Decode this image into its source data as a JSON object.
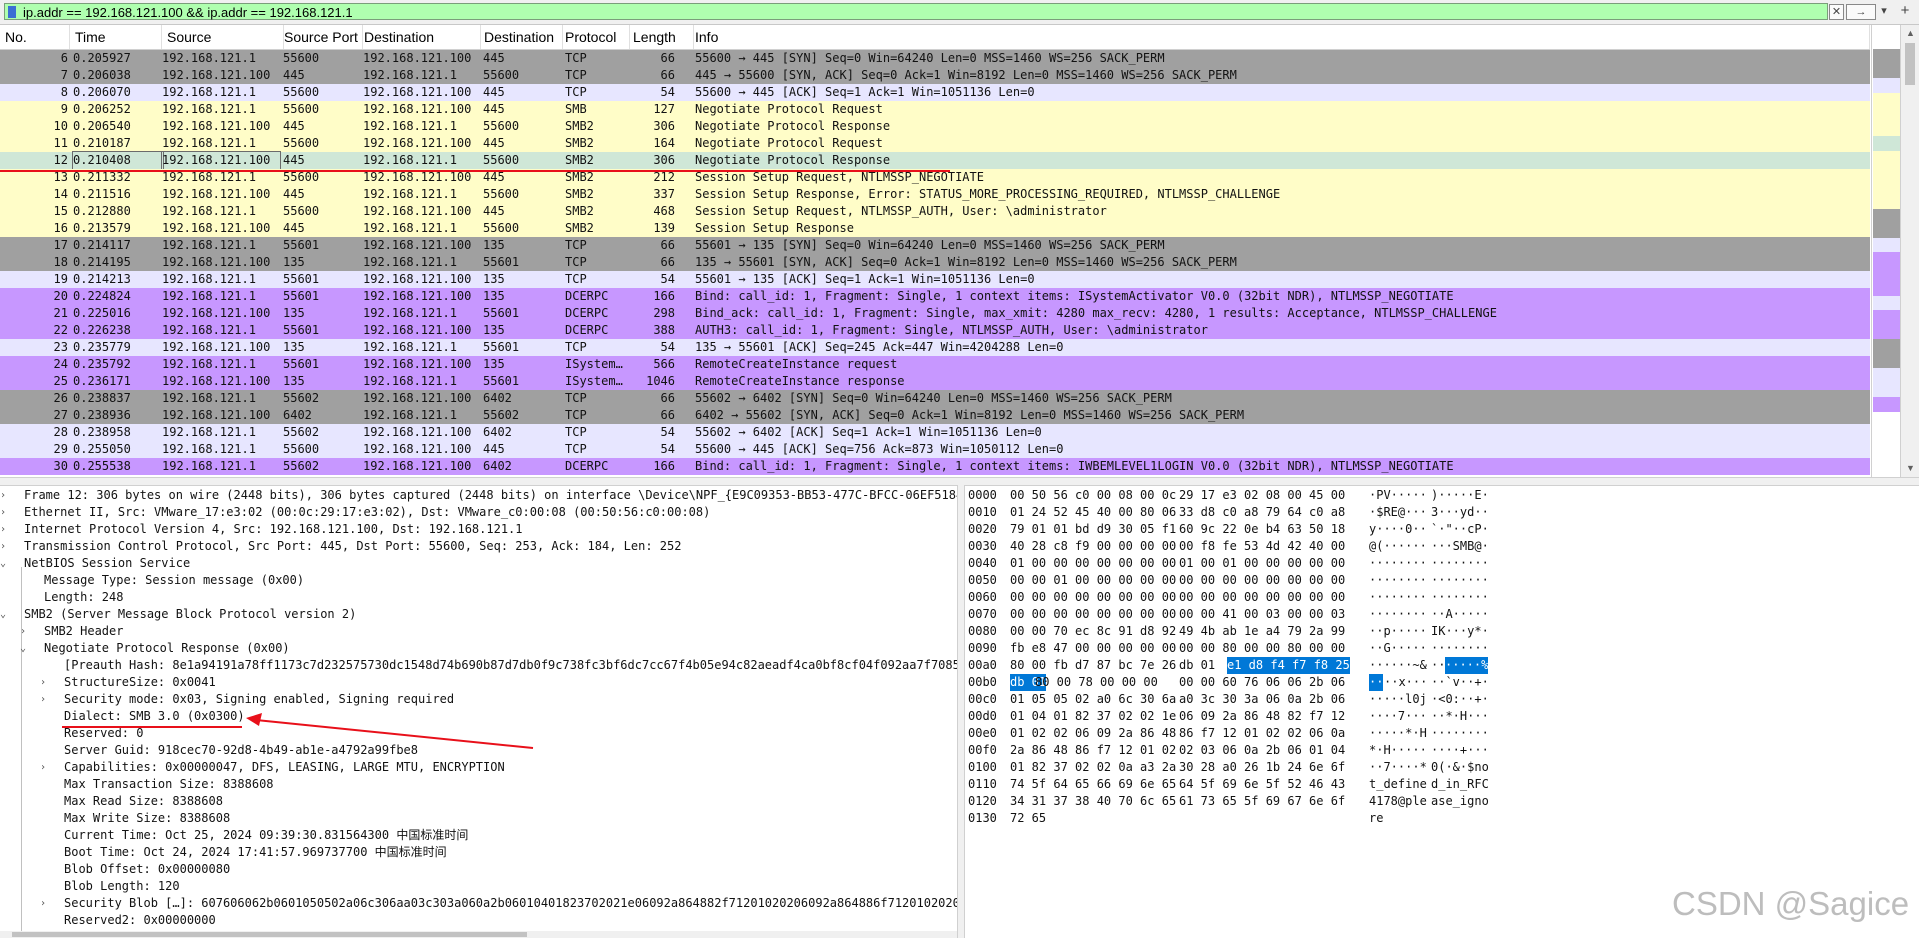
{
  "filter": {
    "value": "ip.addr == 192.168.121.100 && ip.addr == 192.168.121.1",
    "clear_label": "✕",
    "apply_label": "→",
    "dropdown_label": "▾",
    "add_label": "+"
  },
  "columns": [
    "No.",
    "Time",
    "Source",
    "Source Port",
    "Destination",
    "Destination",
    "Protocol",
    "Length",
    "Info"
  ],
  "colors": {
    "tcp_syn": "#a0a0a0",
    "tcp": "#e7e6ff",
    "smb": "#fffdc8",
    "dcerpc": "#c797ff",
    "selected": "#cfe7d7",
    "annotation": "#e8101a",
    "highlight": "#0078d7"
  },
  "packets": [
    {
      "no": "6",
      "time": "0.205927",
      "src": "192.168.121.1",
      "sport": "55600",
      "dst": "192.168.121.100",
      "dport": "445",
      "proto": "TCP",
      "len": "66",
      "info": "55600 → 445 [SYN] Seq=0 Win=64240 Len=0 MSS=1460 WS=256 SACK_PERM",
      "type": "syn"
    },
    {
      "no": "7",
      "time": "0.206038",
      "src": "192.168.121.100",
      "sport": "445",
      "dst": "192.168.121.1",
      "dport": "55600",
      "proto": "TCP",
      "len": "66",
      "info": "445 → 55600 [SYN, ACK] Seq=0 Ack=1 Win=8192 Len=0 MSS=1460 WS=256 SACK_PERM",
      "type": "syn"
    },
    {
      "no": "8",
      "time": "0.206070",
      "src": "192.168.121.1",
      "sport": "55600",
      "dst": "192.168.121.100",
      "dport": "445",
      "proto": "TCP",
      "len": "54",
      "info": "55600 → 445 [ACK] Seq=1 Ack=1 Win=1051136 Len=0",
      "type": "tcp"
    },
    {
      "no": "9",
      "time": "0.206252",
      "src": "192.168.121.1",
      "sport": "55600",
      "dst": "192.168.121.100",
      "dport": "445",
      "proto": "SMB",
      "len": "127",
      "info": "Negotiate Protocol Request",
      "type": "smb"
    },
    {
      "no": "10",
      "time": "0.206540",
      "src": "192.168.121.100",
      "sport": "445",
      "dst": "192.168.121.1",
      "dport": "55600",
      "proto": "SMB2",
      "len": "306",
      "info": "Negotiate Protocol Response",
      "type": "smb"
    },
    {
      "no": "11",
      "time": "0.210187",
      "src": "192.168.121.1",
      "sport": "55600",
      "dst": "192.168.121.100",
      "dport": "445",
      "proto": "SMB2",
      "len": "164",
      "info": "Negotiate Protocol Request",
      "type": "smb"
    },
    {
      "no": "12",
      "time": "0.210408",
      "src": "192.168.121.100",
      "sport": "445",
      "dst": "192.168.121.1",
      "dport": "55600",
      "proto": "SMB2",
      "len": "306",
      "info": "Negotiate Protocol Response",
      "type": "selected"
    },
    {
      "no": "13",
      "time": "0.211332",
      "src": "192.168.121.1",
      "sport": "55600",
      "dst": "192.168.121.100",
      "dport": "445",
      "proto": "SMB2",
      "len": "212",
      "info": "Session Setup Request, NTLMSSP_NEGOTIATE",
      "type": "smb"
    },
    {
      "no": "14",
      "time": "0.211516",
      "src": "192.168.121.100",
      "sport": "445",
      "dst": "192.168.121.1",
      "dport": "55600",
      "proto": "SMB2",
      "len": "337",
      "info": "Session Setup Response, Error: STATUS_MORE_PROCESSING_REQUIRED, NTLMSSP_CHALLENGE",
      "type": "smb"
    },
    {
      "no": "15",
      "time": "0.212880",
      "src": "192.168.121.1",
      "sport": "55600",
      "dst": "192.168.121.100",
      "dport": "445",
      "proto": "SMB2",
      "len": "468",
      "info": "Session Setup Request, NTLMSSP_AUTH, User: \\administrator",
      "type": "smb"
    },
    {
      "no": "16",
      "time": "0.213579",
      "src": "192.168.121.100",
      "sport": "445",
      "dst": "192.168.121.1",
      "dport": "55600",
      "proto": "SMB2",
      "len": "139",
      "info": "Session Setup Response",
      "type": "smb"
    },
    {
      "no": "17",
      "time": "0.214117",
      "src": "192.168.121.1",
      "sport": "55601",
      "dst": "192.168.121.100",
      "dport": "135",
      "proto": "TCP",
      "len": "66",
      "info": "55601 → 135 [SYN] Seq=0 Win=64240 Len=0 MSS=1460 WS=256 SACK_PERM",
      "type": "syn"
    },
    {
      "no": "18",
      "time": "0.214195",
      "src": "192.168.121.100",
      "sport": "135",
      "dst": "192.168.121.1",
      "dport": "55601",
      "proto": "TCP",
      "len": "66",
      "info": "135 → 55601 [SYN, ACK] Seq=0 Ack=1 Win=8192 Len=0 MSS=1460 WS=256 SACK_PERM",
      "type": "syn"
    },
    {
      "no": "19",
      "time": "0.214213",
      "src": "192.168.121.1",
      "sport": "55601",
      "dst": "192.168.121.100",
      "dport": "135",
      "proto": "TCP",
      "len": "54",
      "info": "55601 → 135 [ACK] Seq=1 Ack=1 Win=1051136 Len=0",
      "type": "tcp"
    },
    {
      "no": "20",
      "time": "0.224824",
      "src": "192.168.121.1",
      "sport": "55601",
      "dst": "192.168.121.100",
      "dport": "135",
      "proto": "DCERPC",
      "len": "166",
      "info": "Bind: call_id: 1, Fragment: Single, 1 context items: ISystemActivator V0.0 (32bit NDR), NTLMSSP_NEGOTIATE",
      "type": "dcerpc"
    },
    {
      "no": "21",
      "time": "0.225016",
      "src": "192.168.121.100",
      "sport": "135",
      "dst": "192.168.121.1",
      "dport": "55601",
      "proto": "DCERPC",
      "len": "298",
      "info": "Bind_ack: call_id: 1, Fragment: Single, max_xmit: 4280 max_recv: 4280, 1 results: Acceptance, NTLMSSP_CHALLENGE",
      "type": "dcerpc"
    },
    {
      "no": "22",
      "time": "0.226238",
      "src": "192.168.121.1",
      "sport": "55601",
      "dst": "192.168.121.100",
      "dport": "135",
      "proto": "DCERPC",
      "len": "388",
      "info": "AUTH3: call_id: 1, Fragment: Single, NTLMSSP_AUTH, User: \\administrator",
      "type": "dcerpc"
    },
    {
      "no": "23",
      "time": "0.235779",
      "src": "192.168.121.100",
      "sport": "135",
      "dst": "192.168.121.1",
      "dport": "55601",
      "proto": "TCP",
      "len": "54",
      "info": "135 → 55601 [ACK] Seq=245 Ack=447 Win=4204288 Len=0",
      "type": "tcp"
    },
    {
      "no": "24",
      "time": "0.235792",
      "src": "192.168.121.1",
      "sport": "55601",
      "dst": "192.168.121.100",
      "dport": "135",
      "proto": "ISystem…",
      "len": "566",
      "info": "RemoteCreateInstance request",
      "type": "dcerpc"
    },
    {
      "no": "25",
      "time": "0.236171",
      "src": "192.168.121.100",
      "sport": "135",
      "dst": "192.168.121.1",
      "dport": "55601",
      "proto": "ISystem…",
      "len": "1046",
      "info": "RemoteCreateInstance response",
      "type": "dcerpc"
    },
    {
      "no": "26",
      "time": "0.238837",
      "src": "192.168.121.1",
      "sport": "55602",
      "dst": "192.168.121.100",
      "dport": "6402",
      "proto": "TCP",
      "len": "66",
      "info": "55602 → 6402 [SYN] Seq=0 Win=64240 Len=0 MSS=1460 WS=256 SACK_PERM",
      "type": "syn"
    },
    {
      "no": "27",
      "time": "0.238936",
      "src": "192.168.121.100",
      "sport": "6402",
      "dst": "192.168.121.1",
      "dport": "55602",
      "proto": "TCP",
      "len": "66",
      "info": "6402 → 55602 [SYN, ACK] Seq=0 Ack=1 Win=8192 Len=0 MSS=1460 WS=256 SACK_PERM",
      "type": "syn"
    },
    {
      "no": "28",
      "time": "0.238958",
      "src": "192.168.121.1",
      "sport": "55602",
      "dst": "192.168.121.100",
      "dport": "6402",
      "proto": "TCP",
      "len": "54",
      "info": "55602 → 6402 [ACK] Seq=1 Ack=1 Win=1051136 Len=0",
      "type": "tcp"
    },
    {
      "no": "29",
      "time": "0.255050",
      "src": "192.168.121.1",
      "sport": "55600",
      "dst": "192.168.121.100",
      "dport": "445",
      "proto": "TCP",
      "len": "54",
      "info": "55600 → 445 [ACK] Seq=756 Ack=873 Win=1050112 Len=0",
      "type": "tcp"
    },
    {
      "no": "30",
      "time": "0.255538",
      "src": "192.168.121.1",
      "sport": "55602",
      "dst": "192.168.121.100",
      "dport": "6402",
      "proto": "DCERPC",
      "len": "166",
      "info": "Bind: call_id: 1, Fragment: Single, 1 context items: IWBEMLEVEL1LOGIN V0.0 (32bit NDR), NTLMSSP_NEGOTIATE",
      "type": "dcerpc"
    }
  ],
  "details": [
    {
      "text": "Frame 12: 306 bytes on wire (2448 bits), 306 bytes captured (2448 bits) on interface \\Device\\NPF_{E9C09353-BB53-477C-BFCC-06EF5184AA6",
      "indent": 0,
      "arrow": "›"
    },
    {
      "text": "Ethernet II, Src: VMware_17:e3:02 (00:0c:29:17:e3:02), Dst: VMware_c0:00:08 (00:50:56:c0:00:08)",
      "indent": 0,
      "arrow": "›"
    },
    {
      "text": "Internet Protocol Version 4, Src: 192.168.121.100, Dst: 192.168.121.1",
      "indent": 0,
      "arrow": "›"
    },
    {
      "text": "Transmission Control Protocol, Src Port: 445, Dst Port: 55600, Seq: 253, Ack: 184, Len: 252",
      "indent": 0,
      "arrow": "›"
    },
    {
      "text": "NetBIOS Session Service",
      "indent": 0,
      "arrow": "⌄"
    },
    {
      "text": "Message Type: Session message (0x00)",
      "indent": 1,
      "arrow": ""
    },
    {
      "text": "Length: 248",
      "indent": 1,
      "arrow": ""
    },
    {
      "text": "SMB2 (Server Message Block Protocol version 2)",
      "indent": 0,
      "arrow": "⌄"
    },
    {
      "text": "SMB2 Header",
      "indent": 1,
      "arrow": "›"
    },
    {
      "text": "Negotiate Protocol Response (0x00)",
      "indent": 1,
      "arrow": "⌄"
    },
    {
      "text": "[Preauth Hash: 8e1a94191a78ff1173c7d232575730dc1548d74b690b87d7db0f9c738fc3bf6dc7cc67f4b05e94c82aeadf4ca0bf8cf04f092aa7f70859865",
      "indent": 2,
      "arrow": ""
    },
    {
      "text": "StructureSize: 0x0041",
      "indent": 2,
      "arrow": "›"
    },
    {
      "text": "Security mode: 0x03, Signing enabled, Signing required",
      "indent": 2,
      "arrow": "›"
    },
    {
      "text": "Dialect: SMB 3.0 (0x0300)",
      "indent": 2,
      "arrow": ""
    },
    {
      "text": "Reserved: 0",
      "indent": 2,
      "arrow": ""
    },
    {
      "text": "Server Guid: 918cec70-92d8-4b49-ab1e-a4792a99fbe8",
      "indent": 2,
      "arrow": ""
    },
    {
      "text": "Capabilities: 0x00000047, DFS, LEASING, LARGE MTU, ENCRYPTION",
      "indent": 2,
      "arrow": "›"
    },
    {
      "text": "Max Transaction Size: 8388608",
      "indent": 2,
      "arrow": ""
    },
    {
      "text": "Max Read Size: 8388608",
      "indent": 2,
      "arrow": ""
    },
    {
      "text": "Max Write Size: 8388608",
      "indent": 2,
      "arrow": ""
    },
    {
      "text": "Current Time: Oct 25, 2024 09:39:30.831564300 中国标准时间",
      "indent": 2,
      "arrow": ""
    },
    {
      "text": "Boot Time: Oct 24, 2024 17:41:57.969737700 中国标准时间",
      "indent": 2,
      "arrow": ""
    },
    {
      "text": "Blob Offset: 0x00000080",
      "indent": 2,
      "arrow": ""
    },
    {
      "text": "Blob Length: 120",
      "indent": 2,
      "arrow": ""
    },
    {
      "text": "Security Blob […]: 607606062b0601050502a06c306aa03c303a060a2b06010401823702021e06092a864882f71201020206092a864886f712010202060a",
      "indent": 2,
      "arrow": "›"
    },
    {
      "text": "Reserved2: 0x00000000",
      "indent": 2,
      "arrow": ""
    }
  ],
  "bytes": [
    {
      "off": "0000",
      "h1": "00 50 56 c0 00 08 00 0c",
      "h2": "29 17 e3 02 08 00 45 00",
      "a1": "·PV·····",
      "a2": ")·····E·"
    },
    {
      "off": "0010",
      "h1": "01 24 52 45 40 00 80 06",
      "h2": "33 d8 c0 a8 79 64 c0 a8",
      "a1": "·$RE@···",
      "a2": "3···yd··"
    },
    {
      "off": "0020",
      "h1": "79 01 01 bd d9 30 05 f1",
      "h2": "60 9c 22 0e b4 63 50 18",
      "a1": "y····0··",
      "a2": "`·\"··cP·"
    },
    {
      "off": "0030",
      "h1": "40 28 c8 f9 00 00 00 00",
      "h2": "00 f8 fe 53 4d 42 40 00",
      "a1": "@(······",
      "a2": "···SMB@·"
    },
    {
      "off": "0040",
      "h1": "01 00 00 00 00 00 00 00",
      "h2": "01 00 01 00 00 00 00 00",
      "a1": "········",
      "a2": "········"
    },
    {
      "off": "0050",
      "h1": "00 00 01 00 00 00 00 00",
      "h2": "00 00 00 00 00 00 00 00",
      "a1": "········",
      "a2": "········"
    },
    {
      "off": "0060",
      "h1": "00 00 00 00 00 00 00 00",
      "h2": "00 00 00 00 00 00 00 00",
      "a1": "········",
      "a2": "········"
    },
    {
      "off": "0070",
      "h1": "00 00 00 00 00 00 00 00",
      "h2": "00 00 41 00 03 00 00 03",
      "a1": "········",
      "a2": "··A·····"
    },
    {
      "off": "0080",
      "h1": "00 00 70 ec 8c 91 d8 92",
      "h2": "49 4b ab 1e a4 79 2a 99",
      "a1": "··p·····",
      "a2": "IK···y*·"
    },
    {
      "off": "0090",
      "h1": "fb e8 47 00 00 00 00 00",
      "h2": "00 00 80 00 00 80 00 00",
      "a1": "··G·····",
      "a2": "········"
    },
    {
      "off": "00a0",
      "h1": "80 00 fb d7 87 bc 7e 26",
      "h2": "db 01",
      "h2b": "e1 d8 f4 f7 f8 25",
      "a1": "······~&",
      "a2": "··",
      "a2b": "·····%"
    },
    {
      "off": "00b0",
      "h1b": "db 01",
      "h1": "80 00 78 00 00 00",
      "h2": "00 00 60 76 06 06 2b 06",
      "a1b": "··",
      "a1": "··x···",
      "a2": "··`v··+·"
    },
    {
      "off": "00c0",
      "h1": "01 05 05 02 a0 6c 30 6a",
      "h2": "a0 3c 30 3a 06 0a 2b 06",
      "a1": "·····l0j",
      "a2": "·<0:··+·"
    },
    {
      "off": "00d0",
      "h1": "01 04 01 82 37 02 02 1e",
      "h2": "06 09 2a 86 48 82 f7 12",
      "a1": "····7···",
      "a2": "··*·H···"
    },
    {
      "off": "00e0",
      "h1": "01 02 02 06 09 2a 86 48",
      "h2": "86 f7 12 01 02 02 06 0a",
      "a1": "·····*·H",
      "a2": "········"
    },
    {
      "off": "00f0",
      "h1": "2a 86 48 86 f7 12 01 02",
      "h2": "02 03 06 0a 2b 06 01 04",
      "a1": "*·H·····",
      "a2": "····+···"
    },
    {
      "off": "0100",
      "h1": "01 82 37 02 02 0a a3 2a",
      "h2": "30 28 a0 26 1b 24 6e 6f",
      "a1": "··7····*",
      "a2": "0(·&·$no"
    },
    {
      "off": "0110",
      "h1": "74 5f 64 65 66 69 6e 65",
      "h2": "64 5f 69 6e 5f 52 46 43",
      "a1": "t_define",
      "a2": "d_in_RFC"
    },
    {
      "off": "0120",
      "h1": "34 31 37 38 40 70 6c 65",
      "h2": "61 73 65 5f 69 67 6e 6f",
      "a1": "4178@ple",
      "a2": "ase_igno"
    },
    {
      "off": "0130",
      "h1": "72 65",
      "h2": "",
      "a1": "re",
      "a2": ""
    }
  ],
  "watermark": "CSDN @Sagice"
}
